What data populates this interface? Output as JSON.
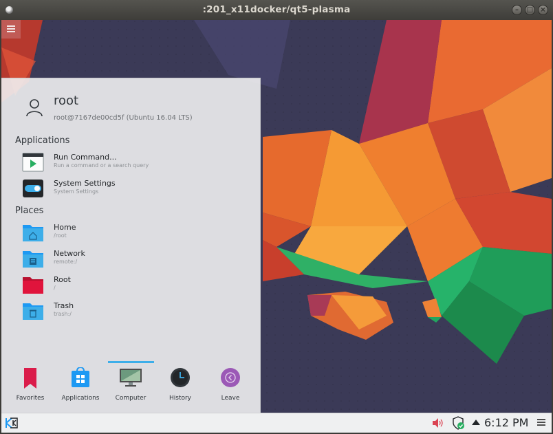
{
  "window": {
    "title": ":201_x11docker/qt5-plasma"
  },
  "user": {
    "name": "root",
    "host": "root@7167de00cd5f (Ubuntu 16.04 LTS)"
  },
  "sections": {
    "applications": "Applications",
    "places": "Places"
  },
  "applications": [
    {
      "title": "Run Command...",
      "subtitle": "Run a command or a search query",
      "icon": "run-command-icon"
    },
    {
      "title": "System Settings",
      "subtitle": "System Settings",
      "icon": "system-settings-icon"
    }
  ],
  "places": [
    {
      "title": "Home",
      "subtitle": "/root",
      "icon": "home-folder-icon",
      "color": "#3daee9"
    },
    {
      "title": "Network",
      "subtitle": "remote:/",
      "icon": "network-folder-icon",
      "color": "#3daee9"
    },
    {
      "title": "Root",
      "subtitle": "/",
      "icon": "root-folder-icon",
      "color": "#e0143c"
    },
    {
      "title": "Trash",
      "subtitle": "trash:/",
      "icon": "trash-folder-icon",
      "color": "#3daee9"
    }
  ],
  "tabs": [
    {
      "label": "Favorites",
      "icon": "bookmark-icon"
    },
    {
      "label": "Applications",
      "icon": "applications-icon"
    },
    {
      "label": "Computer",
      "icon": "computer-icon",
      "active": true
    },
    {
      "label": "History",
      "icon": "clock-icon"
    },
    {
      "label": "Leave",
      "icon": "leave-icon"
    }
  ],
  "panel": {
    "clock": "6:12 PM"
  },
  "colors": {
    "accent": "#3daee9",
    "panel": "#eff0f1"
  }
}
